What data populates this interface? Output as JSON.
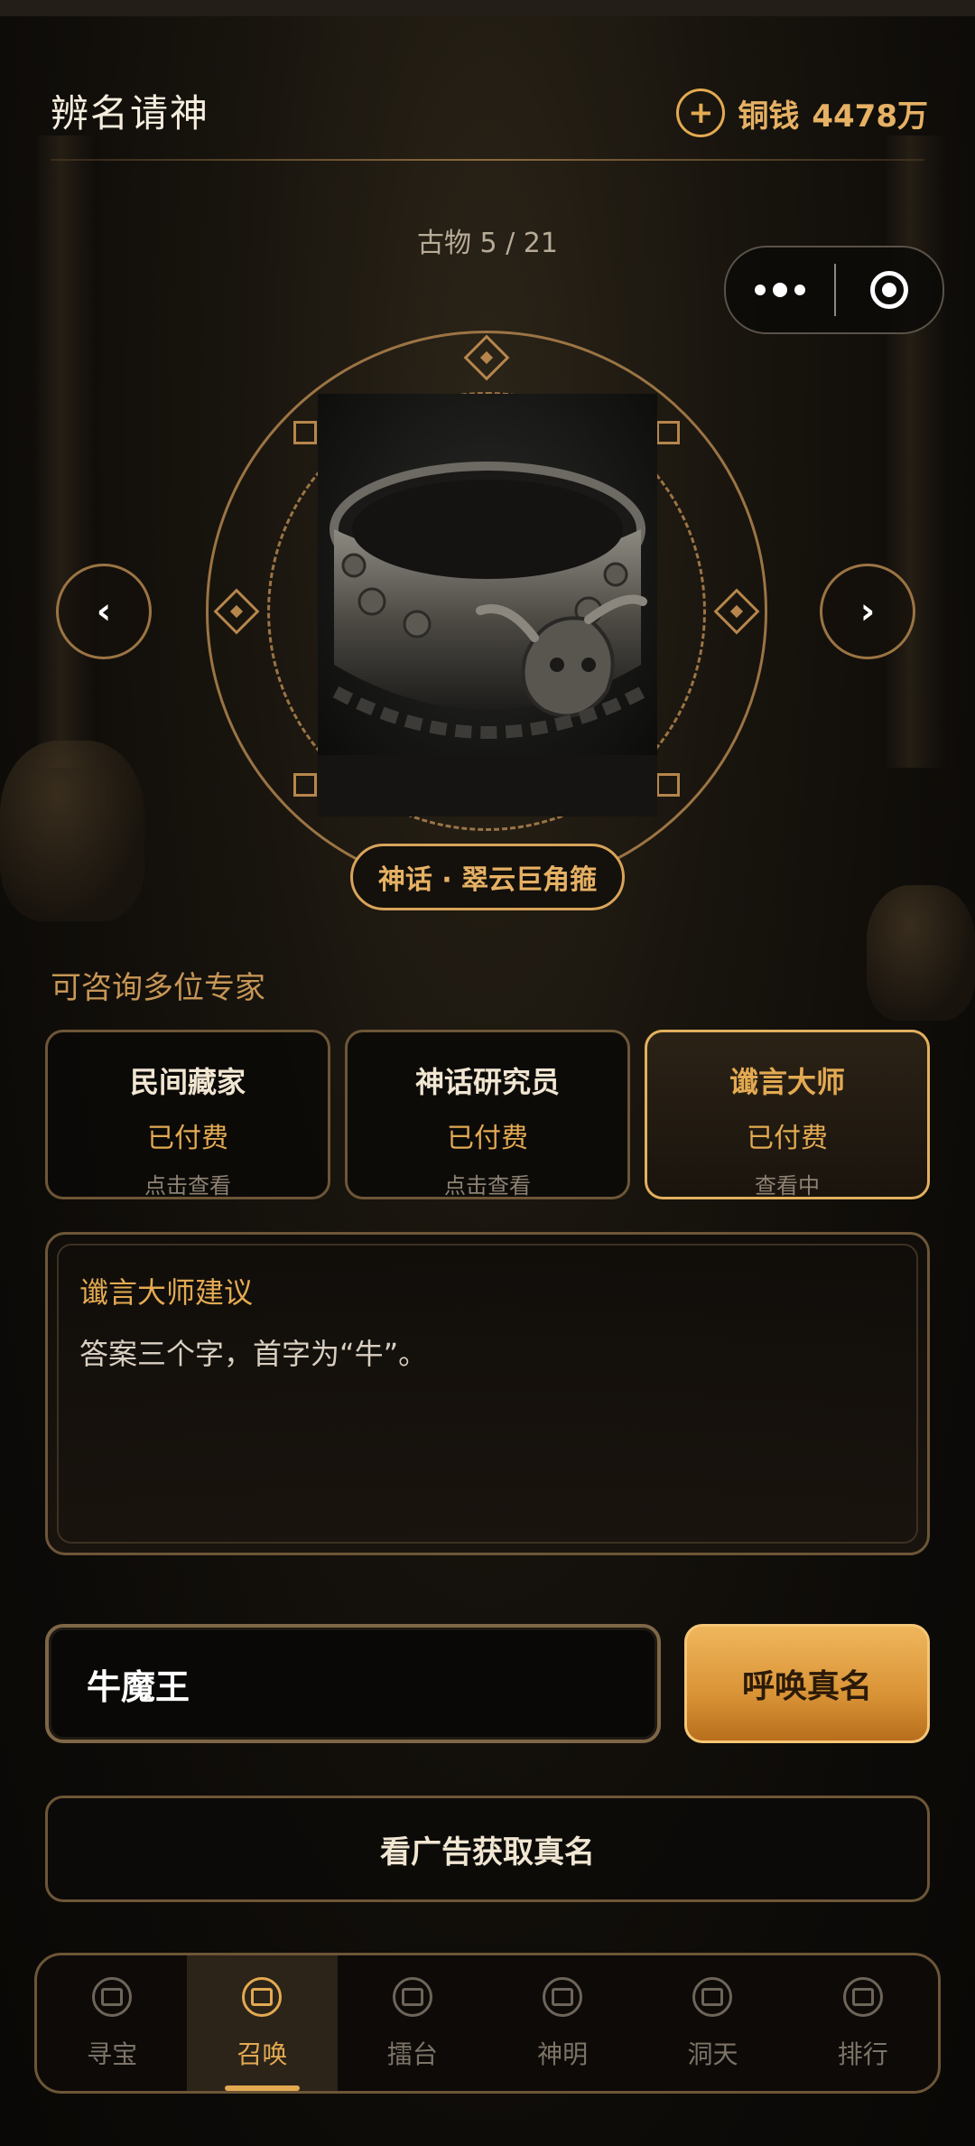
{
  "header": {
    "title": "辨名请神",
    "coin_label": "铜钱",
    "coin_value": "4478万"
  },
  "relic": {
    "counter": "古物 5 / 21",
    "name": "神话 · 翠云巨角箍"
  },
  "experts": {
    "heading": "可咨询多位专家",
    "cards": [
      {
        "name": "民间藏家",
        "status": "已付费",
        "hint": "点击查看"
      },
      {
        "name": "神话研究员",
        "status": "已付费",
        "hint": "点击查看"
      },
      {
        "name": "谶言大师",
        "status": "已付费",
        "hint": "查看中"
      }
    ]
  },
  "advice": {
    "title": "谶言大师建议",
    "text": "答案三个字，首字为“牛”。"
  },
  "answer": {
    "value": "牛魔王"
  },
  "buttons": {
    "summon": "呼唤真名",
    "watch_ad": "看广告获取真名"
  },
  "tabs": [
    {
      "label": "寻宝",
      "icon": "treasure-icon"
    },
    {
      "label": "召唤",
      "icon": "summon-icon"
    },
    {
      "label": "擂台",
      "icon": "arena-icon"
    },
    {
      "label": "神明",
      "icon": "deity-icon"
    },
    {
      "label": "洞天",
      "icon": "cave-icon"
    },
    {
      "label": "排行",
      "icon": "ranking-icon"
    }
  ],
  "active_tab": "召唤",
  "colors": {
    "accent": "#e3aa52",
    "background": "#0d0b08",
    "border": "#6d5637"
  }
}
